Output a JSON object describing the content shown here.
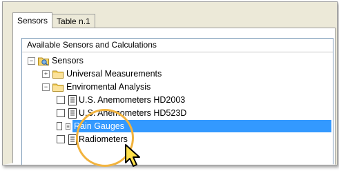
{
  "tabs": [
    {
      "label": "Sensors",
      "active": true
    },
    {
      "label": "Table n.1",
      "active": false
    }
  ],
  "group_title": "Available Sensors and Calculations",
  "tree": {
    "root": {
      "label": "Sensors",
      "expanded": true,
      "icon": "sensors-folder-icon"
    },
    "items": [
      {
        "label": "Universal Measurements",
        "expanded": false,
        "icon": "folder-icon"
      },
      {
        "label": "Enviromental Analysis",
        "expanded": true,
        "icon": "folder-icon"
      }
    ],
    "children": [
      {
        "label": "U.S. Anemometers HD2003",
        "checked": false,
        "icon": "document-icon"
      },
      {
        "label": "U.S. Anemometers HD523D",
        "checked": false,
        "icon": "document-icon"
      },
      {
        "label": "Rain Gauges",
        "checked": false,
        "icon": "document-icon",
        "selected": true
      },
      {
        "label": "Radiometers",
        "checked": false,
        "icon": "document-icon"
      }
    ]
  },
  "colors": {
    "selection": "#3399ff",
    "highlight_ring": "#f2b33d",
    "cursor_fill": "#ffe14a"
  }
}
